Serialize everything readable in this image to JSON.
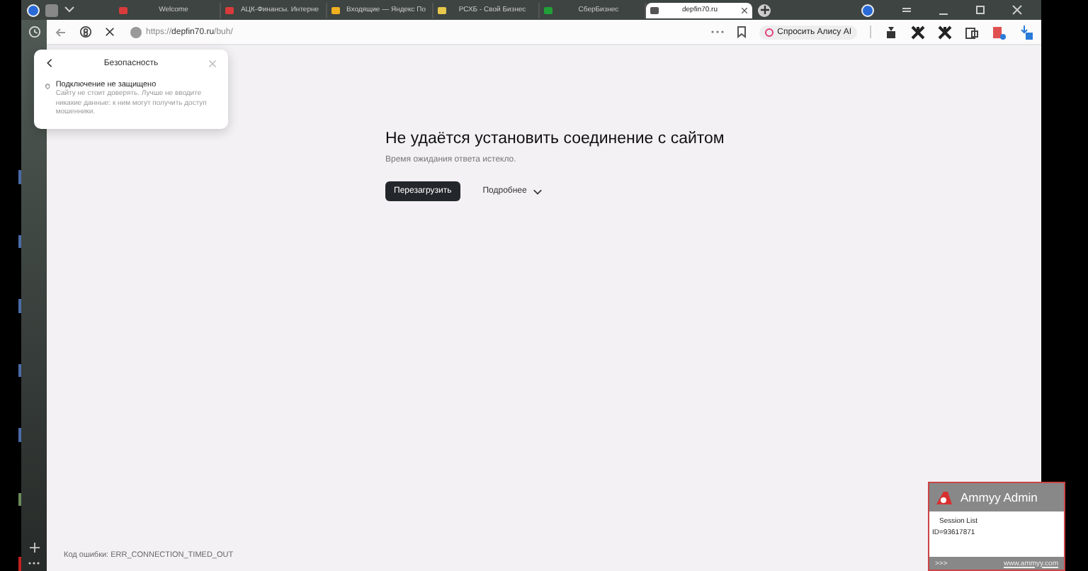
{
  "tabs": [
    {
      "title": "Welcome",
      "selected": false,
      "color": "#d93b3b"
    },
    {
      "title": "АЦК-Финансы. Интерне",
      "selected": false,
      "color": "#d93b3b"
    },
    {
      "title": "Входящие — Яндекс По",
      "selected": false,
      "color": "#f0b020"
    },
    {
      "title": "РСХБ - Свой Бизнес",
      "selected": false,
      "color": "#e8c84a"
    },
    {
      "title": "СберБизнес",
      "selected": false,
      "color": "#21a038"
    },
    {
      "title": "depfin70.ru",
      "selected": true,
      "color": "#555555"
    }
  ],
  "address_bar": {
    "url_prefix": "https://",
    "url_host": "depfin70.ru",
    "url_path": "/buh/",
    "ask_button": "Спросить Алису AI"
  },
  "security_popup": {
    "title": "Безопасность",
    "heading": "Подключение не защищено",
    "text": "Сайту не стоит доверять. Лучше не вводите никакие данные: к ним могут получить доступ мошенники."
  },
  "error_page": {
    "title": "Не удаётся установить соединение с сайтом",
    "subtitle": "Время ожидания ответа истекло.",
    "reload_button": "Перезагрузить",
    "details_button": "Подробнее",
    "error_code": "Код ошибки: ERR_CONNECTION_TIMED_OUT"
  },
  "ammyy": {
    "title": "Ammyy Admin",
    "session_list": "Session List",
    "id": "ID=93617871",
    "more": ">>>",
    "link": "www.ammyy.com"
  }
}
